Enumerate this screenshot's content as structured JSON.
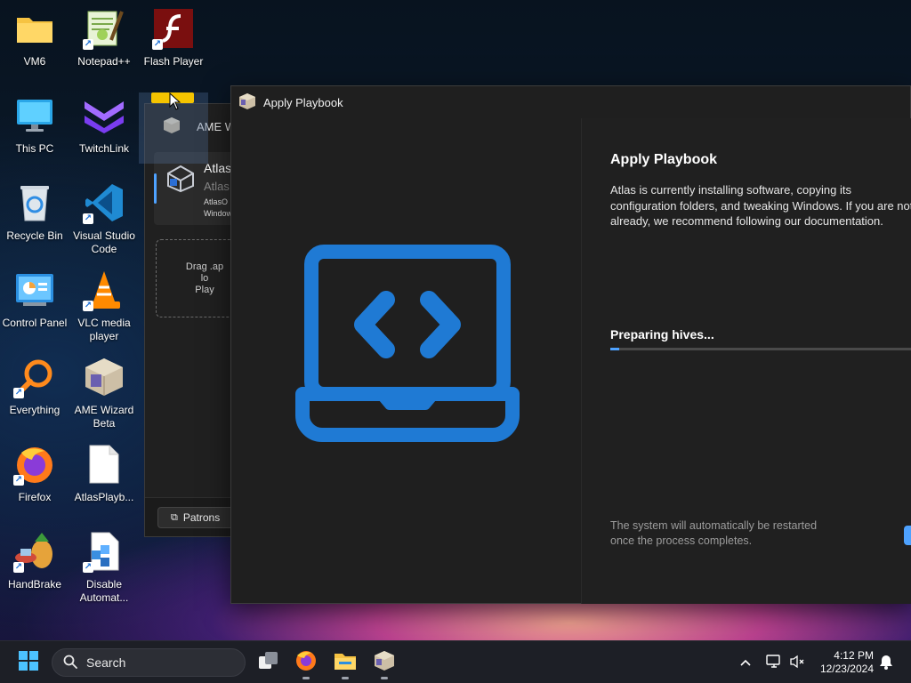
{
  "desktop": {
    "icons": [
      {
        "label": "VM6",
        "icon": "folder-icon"
      },
      {
        "label": "Notepad++",
        "icon": "notepad-plus-plus-icon"
      },
      {
        "label": "Flash Player",
        "icon": "flash-player-icon"
      },
      {
        "label": "This PC",
        "icon": "monitor-icon"
      },
      {
        "label": "TwitchLink",
        "icon": "twitchlink-icon"
      },
      {
        "label": "Recycle Bin",
        "icon": "recycle-bin-icon"
      },
      {
        "label": "Visual Studio Code",
        "icon": "vscode-icon"
      },
      {
        "label": "Control Panel",
        "icon": "control-panel-icon"
      },
      {
        "label": "VLC media player",
        "icon": "vlc-icon"
      },
      {
        "label": "Everything",
        "icon": "everything-search-icon"
      },
      {
        "label": "AME Wizard Beta",
        "icon": "ame-wizard-icon"
      },
      {
        "label": "Firefox",
        "icon": "firefox-icon"
      },
      {
        "label": "AtlasPlayb...",
        "icon": "file-icon"
      },
      {
        "label": "HandBrake",
        "icon": "handbrake-icon"
      },
      {
        "label": "Disable Automat...",
        "icon": "script-file-icon"
      }
    ]
  },
  "ame_window": {
    "title": "AME W",
    "card": {
      "name": "Atlas",
      "subtitle": "Atlas",
      "line1": "AtlasO",
      "line2": "Window"
    },
    "drop_zone": {
      "line1": "Drag .ap",
      "line2": "lo",
      "line3": "Play"
    },
    "patrons_label": "Patrons"
  },
  "apply_window": {
    "title": "Apply Playbook",
    "heading": "Apply Playbook",
    "description": [
      "Atlas is currently installing software, copying its",
      "configuration folders, and tweaking Windows. If you are not",
      "already, we recommend following our documentation."
    ],
    "status": "Preparing hives...",
    "progress_fraction": 0.03,
    "footnote": [
      "The system will automatically be restarted",
      "once the process completes."
    ],
    "colors": {
      "accent": "#4ea2ff",
      "illustration": "#1f7ad4"
    }
  },
  "taskbar": {
    "search_placeholder": "Search",
    "apps": [
      "start-icon",
      "task-view-icon",
      "firefox-icon",
      "file-explorer-icon",
      "ame-wizard-icon"
    ],
    "tray": [
      "chevron-up-icon",
      "network-icon",
      "bluetooth-off-icon"
    ],
    "time": "4:12 PM",
    "date": "12/23/2024",
    "notification_icon": "bell-icon"
  }
}
